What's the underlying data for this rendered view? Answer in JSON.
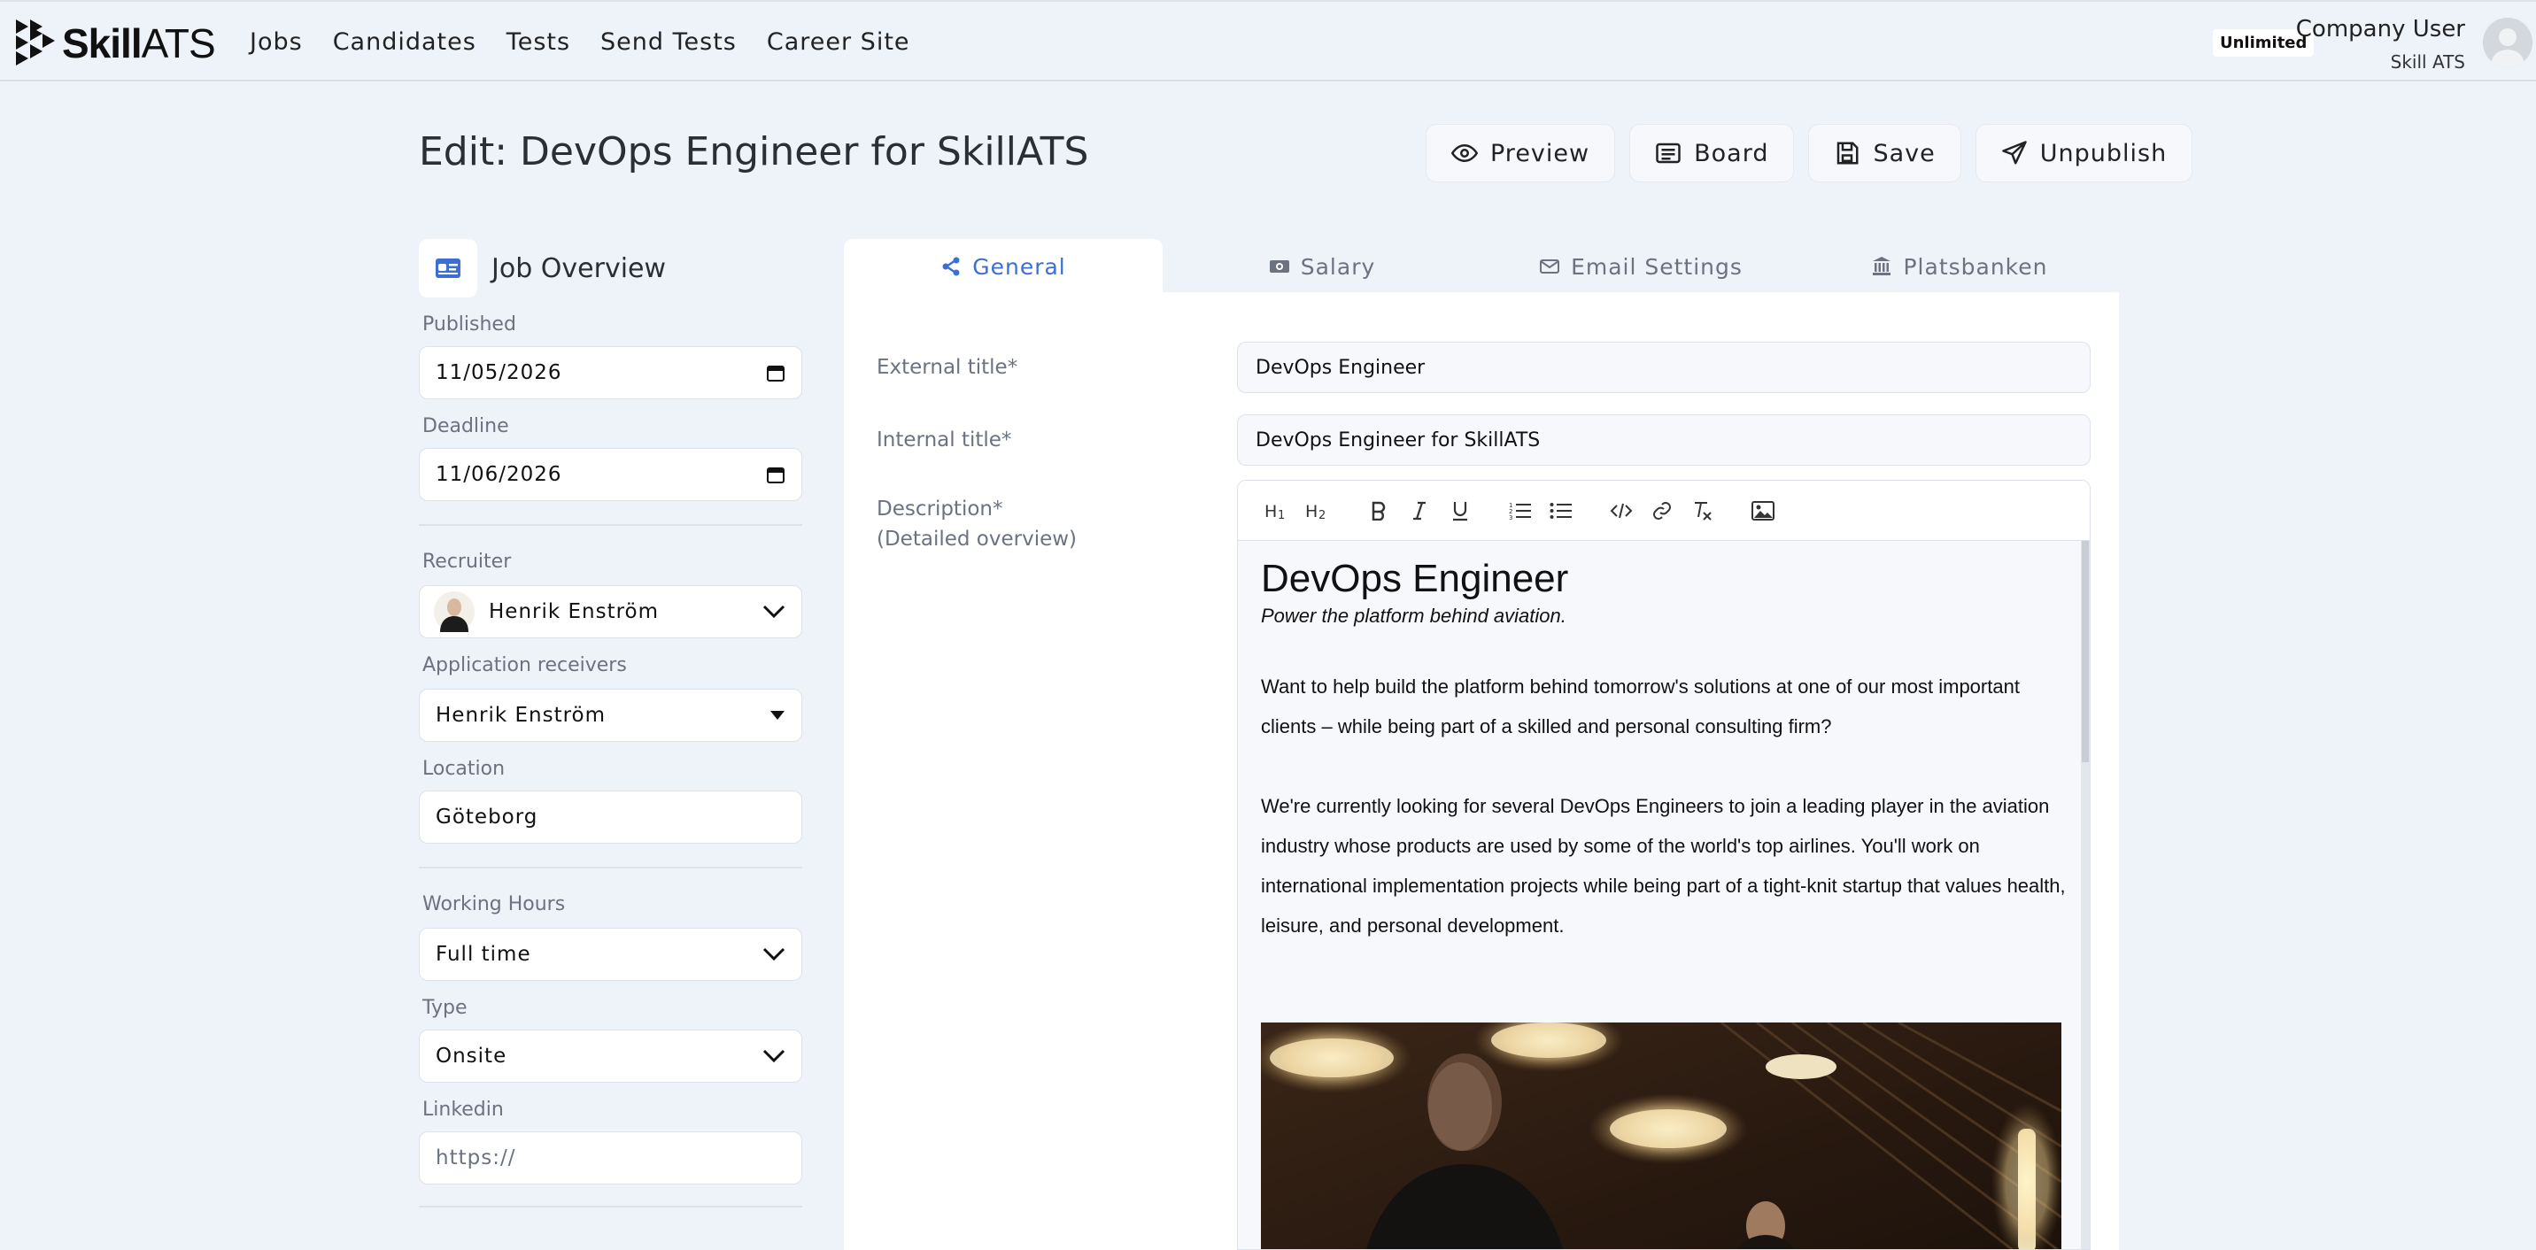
{
  "app": {
    "logo_bold": "Skill",
    "logo_light": "ATS"
  },
  "nav": {
    "items": [
      "Jobs",
      "Candidates",
      "Tests",
      "Send Tests",
      "Career Site"
    ]
  },
  "account": {
    "plan_badge": "Unlimited",
    "user_name": "Company User",
    "company": "Skill ATS"
  },
  "page": {
    "title": "Edit: DevOps Engineer for SkillATS"
  },
  "actions": {
    "preview": "Preview",
    "board": "Board",
    "save": "Save",
    "unpublish": "Unpublish"
  },
  "overview": {
    "title": "Job Overview",
    "published_label": "Published",
    "published_value": "11/05/2026",
    "deadline_label": "Deadline",
    "deadline_value": "11/06/2026",
    "recruiter_label": "Recruiter",
    "recruiter_value": "Henrik Enström",
    "receivers_label": "Application receivers",
    "receivers_value": "Henrik Enström",
    "location_label": "Location",
    "location_value": "Göteborg",
    "hours_label": "Working Hours",
    "hours_value": "Full time",
    "type_label": "Type",
    "type_value": "Onsite",
    "linkedin_label": "Linkedin",
    "linkedin_placeholder": "https://"
  },
  "tabs": [
    {
      "label": "General",
      "icon": "share-icon",
      "active": true
    },
    {
      "label": "Salary",
      "icon": "money-icon",
      "active": false
    },
    {
      "label": "Email Settings",
      "icon": "envelope-icon",
      "active": false
    },
    {
      "label": "Platsbanken",
      "icon": "bank-icon",
      "active": false
    }
  ],
  "form": {
    "external_title_label": "External title*",
    "external_title_value": "DevOps Engineer",
    "internal_title_label": "Internal title*",
    "internal_title_value": "DevOps Engineer for SkillATS",
    "description_label": "Description*",
    "description_sublabel": "(Detailed overview)"
  },
  "editor": {
    "toolbar": [
      "heading-1-icon",
      "heading-2-icon",
      "bold-icon",
      "italic-icon",
      "underline-icon",
      "ordered-list-icon",
      "bullet-list-icon",
      "code-icon",
      "link-icon",
      "clear-format-icon",
      "image-icon"
    ],
    "heading": "DevOps Engineer",
    "tagline": "Power the platform behind aviation.",
    "paragraph1": "Want to help build the platform behind tomorrow's solutions at one of our most important clients – while being part of a skilled and personal consulting firm?",
    "paragraph2": "We're currently looking for several DevOps Engineers to join a leading player in the aviation industry whose products are used by some of the world's top airlines. You'll work on international implementation projects while being part of a tight-knit startup that values health, leisure, and personal development."
  },
  "colors": {
    "background": "#eef2f9",
    "accent": "#3b6fd6"
  }
}
